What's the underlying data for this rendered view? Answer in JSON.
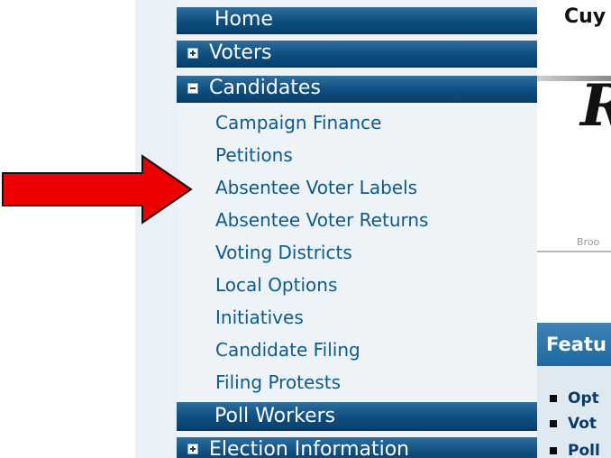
{
  "header": {
    "site_title_partial": "Cuy"
  },
  "nav": {
    "home": "Home",
    "voters": "Voters",
    "candidates": "Candidates",
    "candidates_items": [
      "Campaign Finance",
      "Petitions",
      "Absentee Voter Labels",
      "Absentee Voter Returns",
      "Voting Districts",
      "Local Options",
      "Initiatives",
      "Candidate Filing",
      "Filing Protests"
    ],
    "poll_workers": "Poll Workers",
    "election_information": "Election Information"
  },
  "banner": {
    "partial_letter": "R",
    "caption_partial": "Broo"
  },
  "featured": {
    "title_partial": "Featu",
    "items": [
      "Opt",
      "Vot",
      "Poll"
    ]
  },
  "annotation": {
    "arrow_color": "#ee0000",
    "points_to": "Absentee Voter Labels"
  },
  "colors": {
    "nav_bar": "#0e4e80",
    "link": "#0e5a8c",
    "panel_bg": "#eef3f7"
  }
}
